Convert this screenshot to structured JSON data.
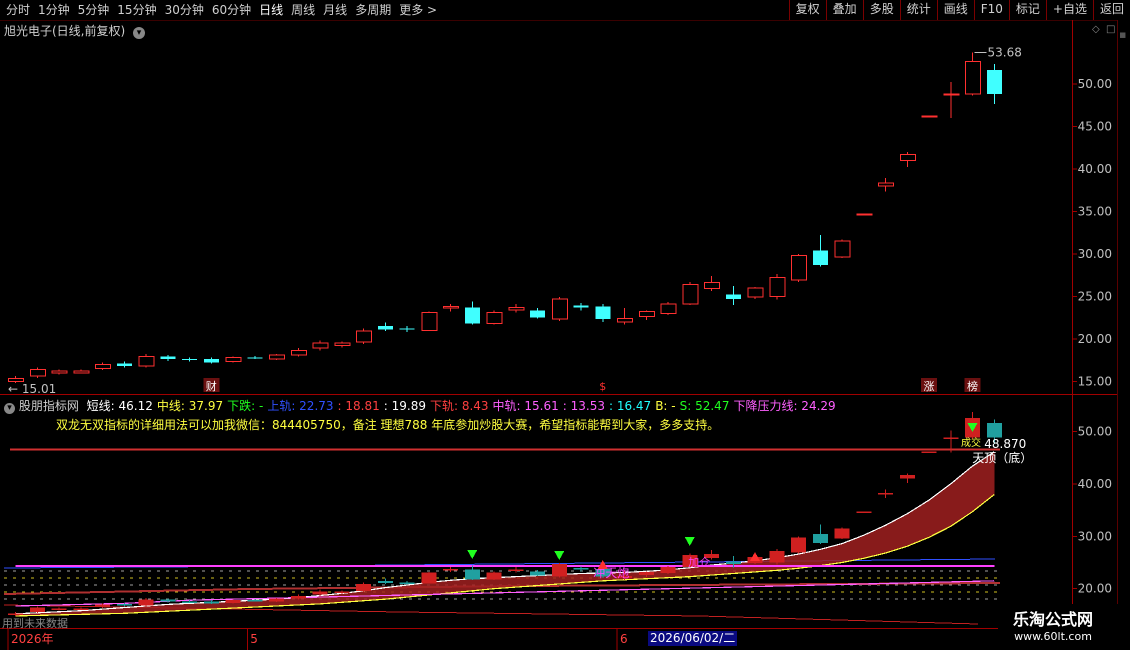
{
  "toolbar": {
    "periods": [
      "分时",
      "1分钟",
      "5分钟",
      "15分钟",
      "30分钟",
      "60分钟",
      "日线",
      "周线",
      "月线",
      "多周期",
      "更多"
    ],
    "active_period": "日线",
    "more_arrow": ">",
    "buttons": [
      "复权",
      "叠加",
      "多股",
      "统计",
      "画线",
      "F10",
      "标记",
      "+自选",
      "返回"
    ]
  },
  "main_title": "旭光电子(日线,前复权)",
  "sub_title": {
    "name": "股朋指标网",
    "items": [
      {
        "label": "短线: 46.12",
        "color": "#ffffff"
      },
      {
        "label": "中线: 37.97",
        "color": "#ffff40"
      },
      {
        "label": "下跌: -",
        "color": "#20ff20"
      },
      {
        "label": "上轨: 22.73",
        "color": "#3050ff"
      },
      {
        "label": ": 18.81",
        "color": "#ff4040"
      },
      {
        "label": ": 19.89",
        "color": "#ffffff"
      },
      {
        "label": "下轨: 8.43",
        "color": "#ff4040"
      },
      {
        "label": "中轨: 15.61",
        "color": "#ff60ff"
      },
      {
        "label": ": 13.53",
        "color": "#ff60ff"
      },
      {
        "label": ": 16.47",
        "color": "#20ffff"
      },
      {
        "label": "B: -",
        "color": "#ffff40"
      },
      {
        "label": "S: 52.47",
        "color": "#20ff20"
      },
      {
        "label": "下降压力线: 24.29",
        "color": "#ff60ff"
      }
    ],
    "note": "双龙无双指标的详细用法可以加我微信：844405750，备注 理想788 年底参加炒股大赛，希望指标能帮到大家，多多支持。"
  },
  "colors": {
    "up": "#ff3030",
    "down": "#40ffff",
    "axis": "#a00000",
    "price_text": "#c0c0c0",
    "ribbon": "#a02020",
    "magenta": "#ff40ff",
    "yellow": "#ffff40"
  },
  "chart_data": [
    {
      "type": "candlestick",
      "title": "旭光电子(日线,前复权)",
      "ylim": [
        13.5,
        57.5
      ],
      "y_ticks": [
        15.0,
        20.0,
        25.0,
        30.0,
        35.0,
        40.0,
        45.0,
        50.0
      ],
      "annotations": {
        "high_label": "53.68",
        "low_label": "15.01"
      },
      "markers": [
        {
          "index": 9,
          "text": "财"
        },
        {
          "index": 27,
          "text": "$"
        },
        {
          "index": 42,
          "text": "涨"
        },
        {
          "index": 44,
          "text": "榜"
        }
      ],
      "candles": [
        {
          "o": 15.0,
          "h": 15.6,
          "l": 14.8,
          "c": 15.3
        },
        {
          "o": 15.6,
          "h": 16.6,
          "l": 15.4,
          "c": 16.4
        },
        {
          "o": 16.0,
          "h": 16.4,
          "l": 15.8,
          "c": 16.2
        },
        {
          "o": 16.0,
          "h": 16.4,
          "l": 15.9,
          "c": 16.2
        },
        {
          "o": 16.5,
          "h": 17.2,
          "l": 16.3,
          "c": 17.0
        },
        {
          "o": 17.1,
          "h": 17.3,
          "l": 16.6,
          "c": 16.8
        },
        {
          "o": 16.8,
          "h": 18.2,
          "l": 16.6,
          "c": 17.9
        },
        {
          "o": 17.9,
          "h": 18.1,
          "l": 17.4,
          "c": 17.6
        },
        {
          "o": 17.6,
          "h": 17.8,
          "l": 17.3,
          "c": 17.5
        },
        {
          "o": 17.6,
          "h": 17.8,
          "l": 17.1,
          "c": 17.2
        },
        {
          "o": 17.3,
          "h": 17.9,
          "l": 17.2,
          "c": 17.8
        },
        {
          "o": 17.8,
          "h": 18.0,
          "l": 17.6,
          "c": 17.7
        },
        {
          "o": 17.6,
          "h": 18.2,
          "l": 17.5,
          "c": 18.1
        },
        {
          "o": 18.1,
          "h": 18.9,
          "l": 17.9,
          "c": 18.6
        },
        {
          "o": 18.9,
          "h": 19.8,
          "l": 18.6,
          "c": 19.5
        },
        {
          "o": 19.2,
          "h": 19.7,
          "l": 19.0,
          "c": 19.5
        },
        {
          "o": 19.6,
          "h": 21.2,
          "l": 19.4,
          "c": 20.9
        },
        {
          "o": 21.5,
          "h": 21.9,
          "l": 20.9,
          "c": 21.1
        },
        {
          "o": 21.2,
          "h": 21.5,
          "l": 20.8,
          "c": 21.1
        },
        {
          "o": 21.0,
          "h": 23.2,
          "l": 21.0,
          "c": 23.1
        },
        {
          "o": 23.6,
          "h": 24.1,
          "l": 23.2,
          "c": 23.8
        },
        {
          "o": 23.7,
          "h": 24.4,
          "l": 21.7,
          "c": 21.8
        },
        {
          "o": 21.8,
          "h": 23.3,
          "l": 21.7,
          "c": 23.1
        },
        {
          "o": 23.4,
          "h": 24.1,
          "l": 23.1,
          "c": 23.7
        },
        {
          "o": 23.3,
          "h": 23.6,
          "l": 22.4,
          "c": 22.5
        },
        {
          "o": 22.3,
          "h": 24.9,
          "l": 22.1,
          "c": 24.7
        },
        {
          "o": 23.9,
          "h": 24.2,
          "l": 23.3,
          "c": 23.7
        },
        {
          "o": 23.8,
          "h": 24.1,
          "l": 22.0,
          "c": 22.3
        },
        {
          "o": 22.0,
          "h": 23.6,
          "l": 21.7,
          "c": 22.4
        },
        {
          "o": 22.6,
          "h": 23.3,
          "l": 22.2,
          "c": 23.2
        },
        {
          "o": 23.0,
          "h": 24.3,
          "l": 22.8,
          "c": 24.1
        },
        {
          "o": 24.1,
          "h": 26.7,
          "l": 24.0,
          "c": 26.4
        },
        {
          "o": 25.9,
          "h": 27.4,
          "l": 25.6,
          "c": 26.6
        },
        {
          "o": 25.2,
          "h": 26.2,
          "l": 24.0,
          "c": 24.7
        },
        {
          "o": 24.9,
          "h": 26.1,
          "l": 24.7,
          "c": 26.0
        },
        {
          "o": 25.0,
          "h": 27.6,
          "l": 24.6,
          "c": 27.2
        },
        {
          "o": 26.9,
          "h": 30.0,
          "l": 26.7,
          "c": 29.8
        },
        {
          "o": 30.4,
          "h": 32.2,
          "l": 28.5,
          "c": 28.7
        },
        {
          "o": 29.6,
          "h": 31.7,
          "l": 29.5,
          "c": 31.5
        },
        {
          "o": 34.7,
          "h": 34.7,
          "l": 34.7,
          "c": 34.7
        },
        {
          "o": 38.0,
          "h": 38.9,
          "l": 37.3,
          "c": 38.3
        },
        {
          "o": 41.0,
          "h": 42.0,
          "l": 40.2,
          "c": 41.7
        },
        {
          "o": 46.2,
          "h": 46.2,
          "l": 46.2,
          "c": 46.2
        },
        {
          "o": 48.8,
          "h": 50.2,
          "l": 46.0,
          "c": 48.8
        },
        {
          "o": 48.8,
          "h": 53.68,
          "l": 48.6,
          "c": 52.6
        },
        {
          "o": 51.6,
          "h": 52.3,
          "l": 47.6,
          "c": 48.8
        }
      ]
    },
    {
      "type": "line",
      "title": "股朋指标网",
      "ylim": [
        12.5,
        56.0
      ],
      "y_ticks": [
        20.0,
        30.0,
        40.0,
        50.0
      ],
      "annotations": {
        "value_label": "48.870",
        "labels": [
          "天顶（底）",
          "成交",
          "冲天炮",
          "加仓"
        ]
      },
      "series": [
        {
          "name": "短线",
          "values": [
            15.2,
            15.4,
            15.6,
            15.8,
            16.1,
            16.4,
            16.7,
            17.0,
            17.2,
            17.4,
            17.6,
            17.8,
            18.0,
            18.3,
            18.7,
            19.1,
            19.6,
            20.2,
            20.7,
            21.2,
            21.6,
            21.9,
            22.1,
            22.3,
            22.5,
            22.7,
            22.9,
            23.0,
            23.1,
            23.3,
            23.6,
            24.0,
            24.5,
            24.9,
            25.3,
            25.9,
            26.6,
            27.5,
            28.6,
            30.2,
            32.1,
            34.3,
            36.9,
            40.0,
            43.4,
            46.12
          ]
        },
        {
          "name": "中线",
          "values": [
            14.8,
            14.9,
            15.0,
            15.1,
            15.2,
            15.3,
            15.5,
            15.7,
            15.9,
            16.1,
            16.3,
            16.5,
            16.7,
            16.9,
            17.1,
            17.4,
            17.7,
            18.0,
            18.4,
            18.8,
            19.2,
            19.6,
            20.0,
            20.3,
            20.6,
            20.9,
            21.2,
            21.5,
            21.7,
            21.9,
            22.1,
            22.3,
            22.6,
            22.9,
            23.2,
            23.5,
            23.9,
            24.4,
            25.0,
            25.8,
            26.8,
            28.1,
            29.8,
            31.9,
            34.7,
            37.97
          ]
        },
        {
          "name": "中轨",
          "values": [
            16.7,
            16.8,
            16.9,
            17.0,
            17.1,
            17.2,
            17.4,
            17.6,
            17.8,
            17.9,
            18.0,
            18.1,
            18.2,
            18.3,
            18.4,
            18.5,
            18.6,
            18.7,
            18.8,
            18.9,
            19.0,
            19.1,
            19.2,
            19.3,
            19.4,
            19.5,
            19.6,
            19.7,
            19.8,
            19.9,
            20.0,
            20.1,
            20.2,
            20.3,
            20.4,
            20.5,
            20.6,
            20.7,
            20.8,
            20.9,
            21.0,
            21.1,
            21.2,
            21.3,
            21.4,
            21.5
          ]
        },
        {
          "name": "下降压力线",
          "values": [
            24.29,
            24.29,
            24.29,
            24.29,
            24.29,
            24.29,
            24.29,
            24.29,
            24.29,
            24.29,
            24.29,
            24.29,
            24.29,
            24.29,
            24.29,
            24.29,
            24.29,
            24.29,
            24.29,
            24.29,
            24.29,
            24.29,
            24.29,
            24.29,
            24.29,
            24.29,
            24.29,
            24.29,
            24.29,
            24.29,
            24.29,
            24.29,
            24.29,
            24.29,
            24.29,
            24.29,
            24.29,
            24.29,
            24.29,
            24.29,
            24.29,
            24.29,
            24.29,
            24.29,
            24.29,
            24.29
          ]
        }
      ]
    }
  ],
  "time_axis": {
    "labels": [
      "2026年",
      "5",
      "6"
    ],
    "label_index": [
      0,
      11,
      28
    ],
    "selected_date": "2026/06/02/二"
  },
  "bottom_note": "用到未来数据",
  "watermark": {
    "name": "乐淘公式网",
    "url": "www.60lt.com"
  }
}
